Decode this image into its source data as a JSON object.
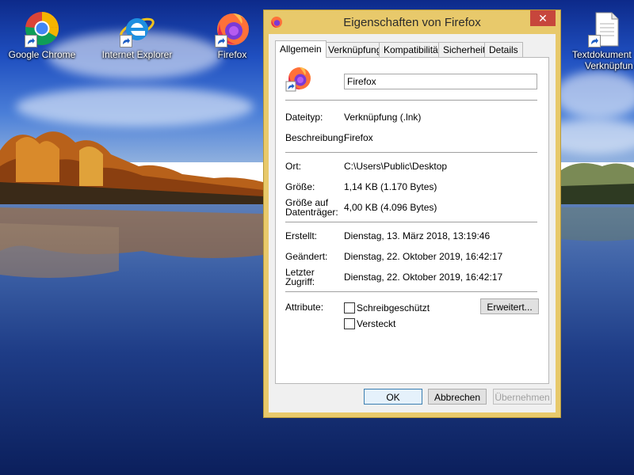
{
  "desktop": {
    "icons": [
      {
        "label": "Google Chrome",
        "icon": "chrome-icon"
      },
      {
        "label": "Internet Explorer",
        "icon": "internet-explorer-icon"
      },
      {
        "label": "Firefox",
        "icon": "firefox-icon"
      },
      {
        "label_line1": "Textdokument",
        "label_line2": "Verknüpfun",
        "icon": "text-document-icon"
      }
    ]
  },
  "dialog": {
    "title": "Eigenschaften von Firefox",
    "close_glyph": "✕",
    "tabs": [
      "Allgemein",
      "Verknüpfung",
      "Kompatibilität",
      "Sicherheit",
      "Details"
    ],
    "active_tab": "Allgemein",
    "name_value": "Firefox",
    "fields": {
      "type_label": "Dateityp:",
      "type_value": "Verknüpfung (.lnk)",
      "desc_label": "Beschreibung:",
      "desc_value": "Firefox",
      "location_label": "Ort:",
      "location_value": "C:\\Users\\Public\\Desktop",
      "size_label": "Größe:",
      "size_value": "1,14 KB (1.170 Bytes)",
      "disk_label_1": "Größe auf",
      "disk_label_2": "Datenträger:",
      "disk_value": "4,00 KB (4.096 Bytes)",
      "created_label": "Erstellt:",
      "created_value": "Dienstag, 13. März 2018, 13:19:46",
      "modified_label": "Geändert:",
      "modified_value": "Dienstag, 22. Oktober 2019, 16:42:17",
      "access_label_1": "Letzter",
      "access_label_2": "Zugriff:",
      "access_value": "Dienstag, 22. Oktober 2019, 16:42:17",
      "attributes_label": "Attribute:"
    },
    "attributes": [
      {
        "label": "Schreibgeschützt",
        "checked": false
      },
      {
        "label": "Versteckt",
        "checked": false
      }
    ],
    "advanced_button": "Erweitert...",
    "buttons": {
      "ok": "OK",
      "cancel": "Abbrechen",
      "apply": "Übernehmen"
    }
  },
  "colors": {
    "window_frame": "#e8c96b",
    "close_button": "#c7463c",
    "default_button_border": "#3c7fb1"
  }
}
